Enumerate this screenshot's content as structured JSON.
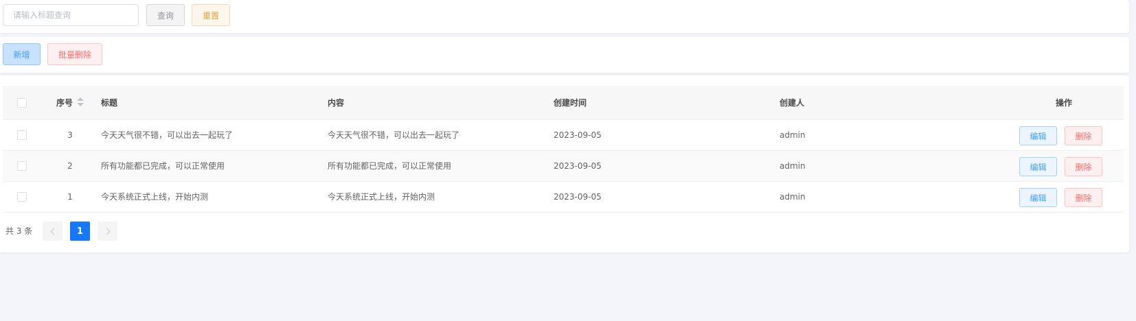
{
  "search": {
    "placeholder": "请输入标题查询",
    "value": "",
    "query_label": "查询",
    "reset_label": "重置"
  },
  "actions": {
    "add_label": "新增",
    "batch_delete_label": "批量删除"
  },
  "table": {
    "columns": {
      "seq": "序号",
      "title": "标题",
      "content": "内容",
      "created_at": "创建时间",
      "creator": "创建人",
      "ops": "操作"
    },
    "rows": [
      {
        "seq": "3",
        "title": "今天天气很不错，可以出去一起玩了",
        "content": "今天天气很不错，可以出去一起玩了",
        "created_at": "2023-09-05",
        "creator": "admin"
      },
      {
        "seq": "2",
        "title": "所有功能都已完成，可以正常使用",
        "content": "所有功能都已完成，可以正常使用",
        "created_at": "2023-09-05",
        "creator": "admin"
      },
      {
        "seq": "1",
        "title": "今天系统正式上线，开始内测",
        "content": "今天系统正式上线，开始内测",
        "created_at": "2023-09-05",
        "creator": "admin"
      }
    ],
    "edit_label": "编辑",
    "delete_label": "删除"
  },
  "pagination": {
    "total_text": "共 3 条",
    "current_page": "1"
  },
  "colors": {
    "primary": "#1677ff",
    "danger": "#f56c6c",
    "warning": "#e6a23c",
    "page_bg": "#f3f5fb"
  }
}
